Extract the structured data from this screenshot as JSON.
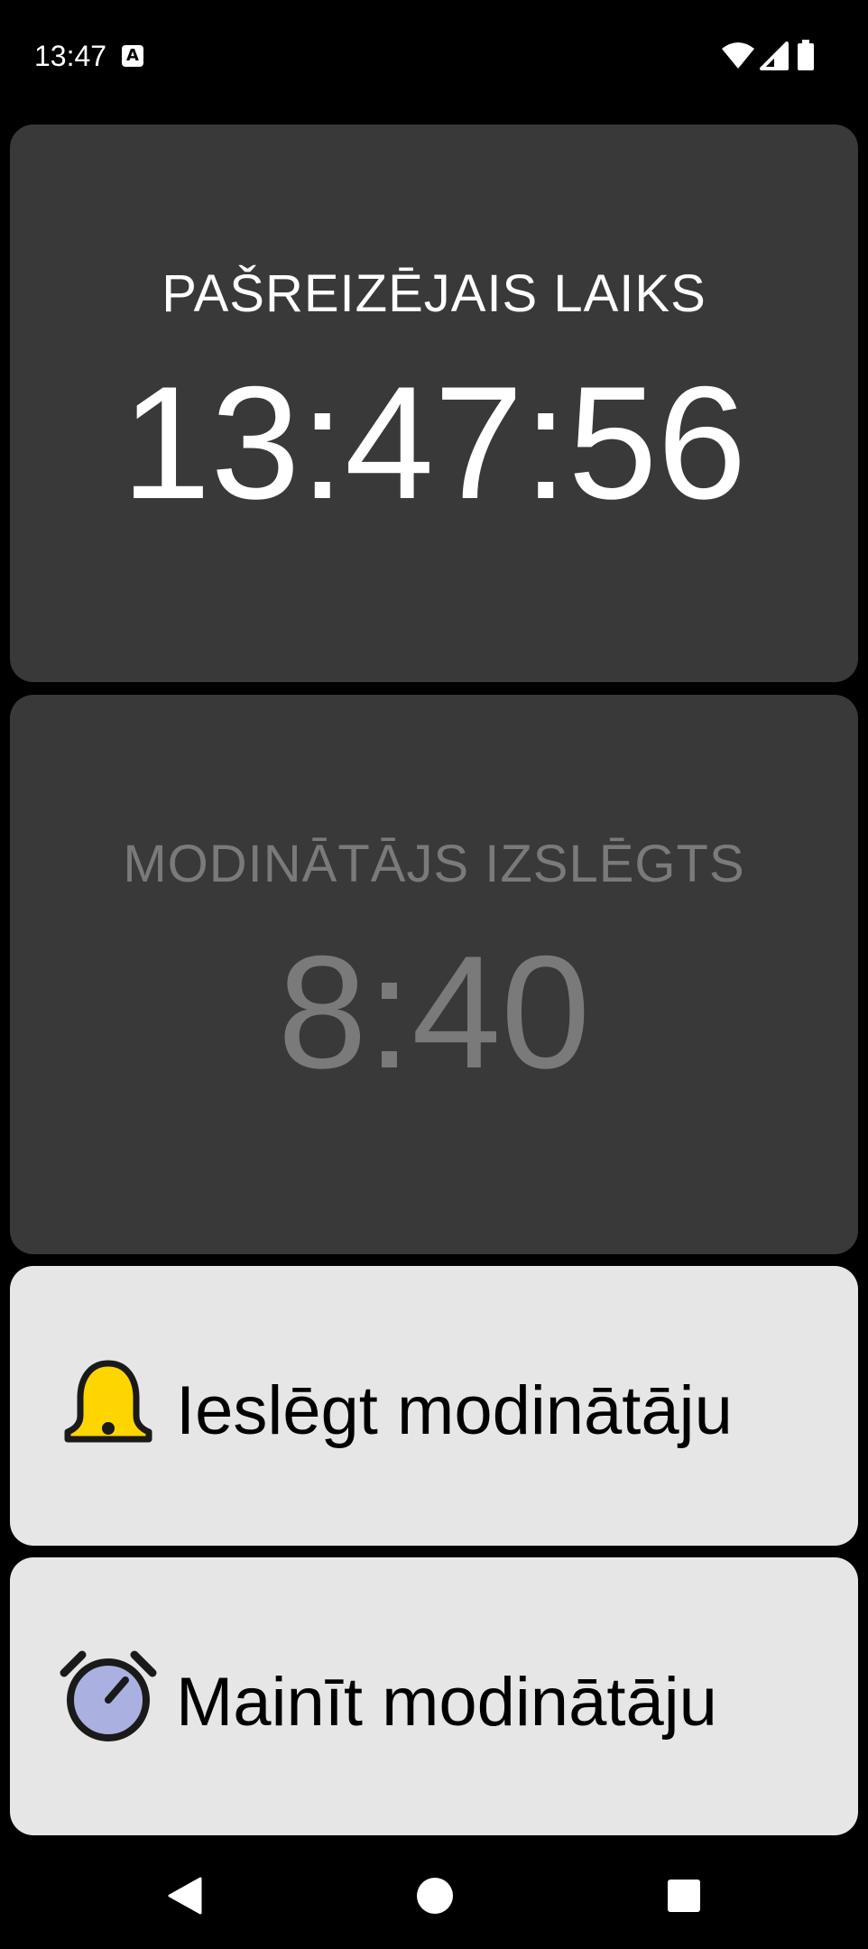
{
  "status_bar": {
    "time": "13:47",
    "badge_letter": "A",
    "icons": [
      "wifi-icon",
      "cellular-signal-icon",
      "battery-icon"
    ]
  },
  "current_time_card": {
    "label": "PAŠREIZĒJAIS LAIKS",
    "value": "13:47:56"
  },
  "alarm_card": {
    "label": "MODINĀTĀJS IZSLĒGTS",
    "value": "8:40"
  },
  "buttons": {
    "enable_alarm": {
      "label": "Ieslēgt modinātāju",
      "icon": "bell-icon"
    },
    "change_alarm": {
      "label": "Mainīt modinātāju",
      "icon": "alarm-clock-icon"
    }
  },
  "navigation": {
    "icons": [
      "back-icon",
      "home-icon",
      "recents-icon"
    ]
  },
  "colors": {
    "background": "#000000",
    "card_dark": "#393939",
    "card_light": "#e6e6e6",
    "text_primary": "#ffffff",
    "text_disabled": "#7a7a7a",
    "bell_yellow": "#ffd500",
    "clock_face": "#aab0e0"
  }
}
